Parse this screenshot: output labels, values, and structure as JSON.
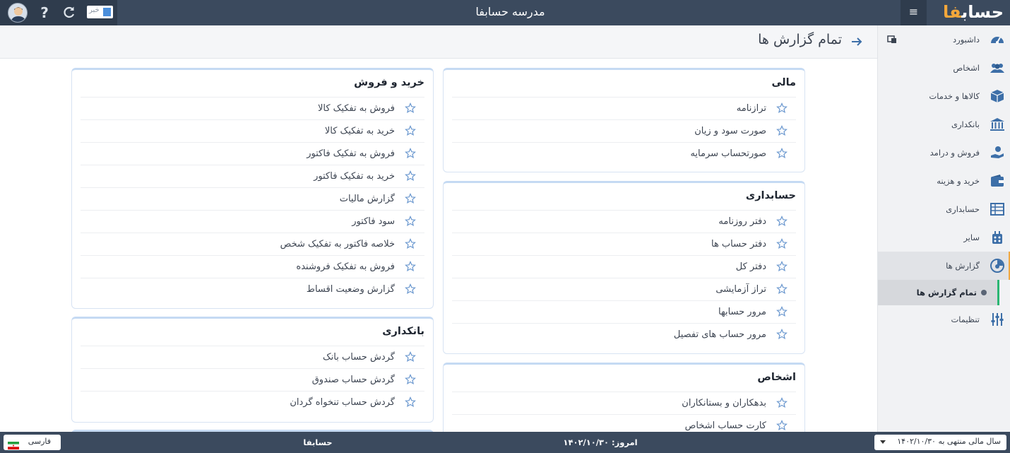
{
  "header": {
    "title": "مدرسه حسابفا",
    "logo_text": "حساب",
    "logo_accent": "فا",
    "news_label": "خبر"
  },
  "sidebar": {
    "items": [
      {
        "label": "داشبورد",
        "icon": "dashboard-icon"
      },
      {
        "label": "اشخاص",
        "icon": "people-icon"
      },
      {
        "label": "کالاها و خدمات",
        "icon": "box-icon"
      },
      {
        "label": "بانکداری",
        "icon": "bank-icon"
      },
      {
        "label": "فروش و درامد",
        "icon": "sales-icon"
      },
      {
        "label": "خرید و هزینه",
        "icon": "wallet-icon"
      },
      {
        "label": "حسابداری",
        "icon": "ledger-icon"
      },
      {
        "label": "سایر",
        "icon": "other-icon"
      },
      {
        "label": "گزارش ها",
        "icon": "report-icon"
      },
      {
        "label": "تنظیمات",
        "icon": "settings-icon"
      }
    ],
    "active_sub": "تمام گزارش ها"
  },
  "page": {
    "title": "تمام گزارش ها"
  },
  "cards": {
    "financial": {
      "title": "مالی",
      "items": [
        "ترازنامه",
        "صورت سود و زیان",
        "صورتحساب سرمایه"
      ]
    },
    "accounting": {
      "title": "حسابداری",
      "items": [
        "دفتر روزنامه",
        "دفتر حساب ها",
        "دفتر کل",
        "تراز آزمایشی",
        "مرور حسابها",
        "مرور حساب های تفصیل"
      ]
    },
    "persons": {
      "title": "اشخاص",
      "items": [
        "بدهکاران و بستانکاران",
        "کارت حساب اشخاص"
      ]
    },
    "buy_sell": {
      "title": "خرید و فروش",
      "items": [
        "فروش به تفکیک کالا",
        "خرید به تفکیک کالا",
        "فروش به تفکیک فاکتور",
        "خرید به تفکیک فاکتور",
        "گزارش مالیات",
        "سود فاکتور",
        "خلاصه فاکتور به تفکیک شخص",
        "فروش به تفکیک فروشنده",
        "گزارش وضعیت اقساط"
      ]
    },
    "banking": {
      "title": "بانکداری",
      "items": [
        "گردش حساب بانک",
        "گردش حساب صندوق",
        "گردش حساب تنخواه گردان"
      ]
    }
  },
  "footer": {
    "language": "فارسی",
    "brand": "حسابفا",
    "today": "امروز: ۱۴۰۲/۱۰/۳۰",
    "fiscal_year": "سال مالی منتهی به ۱۴۰۲/۱۰/۳۰"
  },
  "colors": {
    "topbar": "#3b4a5e",
    "accent_orange": "#f3a73b",
    "icon_blue": "#3d6fa8",
    "star_blue": "#6b98cf"
  }
}
